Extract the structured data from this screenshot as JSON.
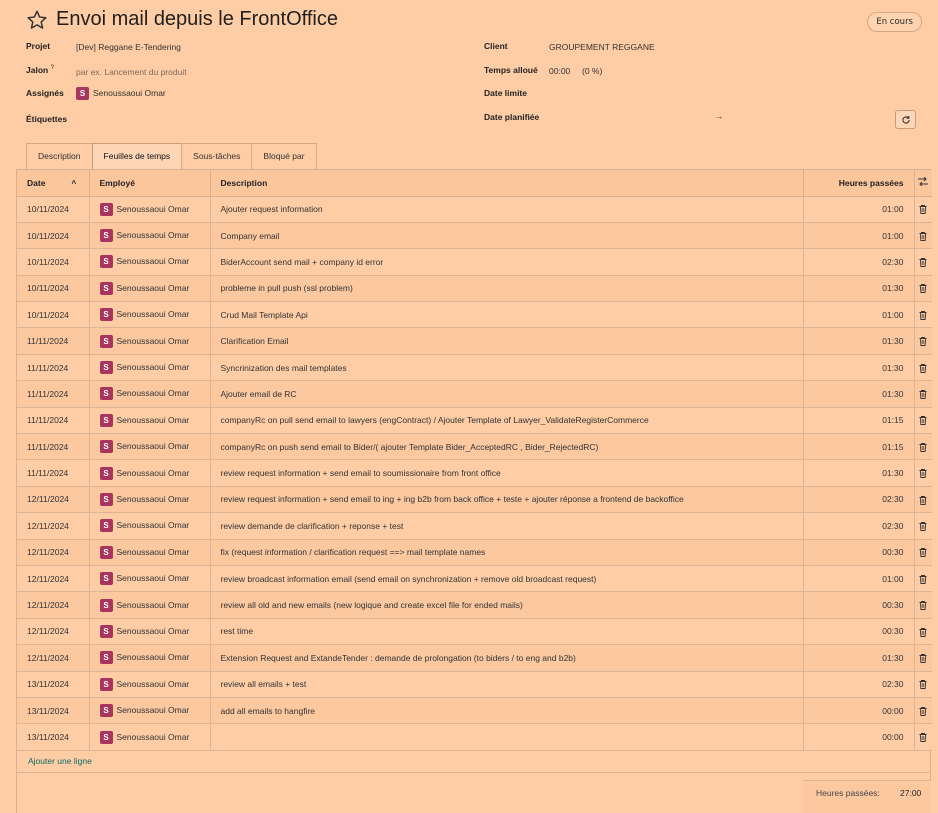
{
  "header": {
    "title": "Envoi mail depuis le FrontOffice",
    "status": "En cours"
  },
  "fields": {
    "project_label": "Projet",
    "project_value": "[Dev] Reggane E-Tendering",
    "milestone_label": "Jalon",
    "milestone_sup": "?",
    "milestone_placeholder": "par ex. Lancement du produit",
    "assignees_label": "Assignés",
    "assignee_initial": "S",
    "assignee_name": "Senoussaoui Omar",
    "tags_label": "Étiquettes",
    "client_label": "Client",
    "client_value": "GROUPEMENT REGGANE",
    "time_label": "Temps alloué",
    "time_value": "00:00",
    "time_percent": "(0 %)",
    "deadline_label": "Date limite",
    "planned_label": "Date planifiée",
    "planned_arrow": "→"
  },
  "tabs": [
    "Description",
    "Feuilles de temps",
    "Sous-tâches",
    "Bloqué par"
  ],
  "table": {
    "headers": {
      "date": "Date",
      "employee": "Employé",
      "description": "Description",
      "hours": "Heures passées"
    },
    "rows": [
      {
        "date": "10/11/2024",
        "employee": "Senoussaoui Omar",
        "description": "Ajouter request information",
        "hours": "01:00"
      },
      {
        "date": "10/11/2024",
        "employee": "Senoussaoui Omar",
        "description": "Company email",
        "hours": "01:00"
      },
      {
        "date": "10/11/2024",
        "employee": "Senoussaoui Omar",
        "description": "BiderAccount send mail + company id error",
        "hours": "02:30"
      },
      {
        "date": "10/11/2024",
        "employee": "Senoussaoui Omar",
        "description": "probleme in pull push (ssl problem)",
        "hours": "01:30"
      },
      {
        "date": "10/11/2024",
        "employee": "Senoussaoui Omar",
        "description": "Crud Mail Template Api",
        "hours": "01:00"
      },
      {
        "date": "11/11/2024",
        "employee": "Senoussaoui Omar",
        "description": "Clarification Email",
        "hours": "01:30"
      },
      {
        "date": "11/11/2024",
        "employee": "Senoussaoui Omar",
        "description": "Syncrinization des mail templates",
        "hours": "01:30"
      },
      {
        "date": "11/11/2024",
        "employee": "Senoussaoui Omar",
        "description": "Ajouter email de RC",
        "hours": "01:30"
      },
      {
        "date": "11/11/2024",
        "employee": "Senoussaoui Omar",
        "description": "companyRc on pull send email to lawyers (engContract) / Ajouter Template of Lawyer_ValidateRegisterCommerce",
        "hours": "01:15"
      },
      {
        "date": "11/11/2024",
        "employee": "Senoussaoui Omar",
        "description": "companyRc on push send email to Bider/( ajouter Template Bider_AcceptedRC , Bider_RejectedRC)",
        "hours": "01:15"
      },
      {
        "date": "11/11/2024",
        "employee": "Senoussaoui Omar",
        "description": "review request information + send email to soumissionaire from front office",
        "hours": "01:30"
      },
      {
        "date": "12/11/2024",
        "employee": "Senoussaoui Omar",
        "description": "review request information + send email to ing + ing b2b from back office + teste + ajouter réponse a frontend de backoffice",
        "hours": "02:30"
      },
      {
        "date": "12/11/2024",
        "employee": "Senoussaoui Omar",
        "description": "review demande de clarification + reponse + test",
        "hours": "02:30"
      },
      {
        "date": "12/11/2024",
        "employee": "Senoussaoui Omar",
        "description": "fix (request information / clarification request ==> mail template names",
        "hours": "00:30"
      },
      {
        "date": "12/11/2024",
        "employee": "Senoussaoui Omar",
        "description": "review broadcast information email (send email on synchronization + remove old broadcast request)",
        "hours": "01:00"
      },
      {
        "date": "12/11/2024",
        "employee": "Senoussaoui Omar",
        "description": "review all old and new emails (new logique and create excel file for ended mails)",
        "hours": "00:30"
      },
      {
        "date": "12/11/2024",
        "employee": "Senoussaoui Omar",
        "description": "rest time",
        "hours": "00:30"
      },
      {
        "date": "12/11/2024",
        "employee": "Senoussaoui Omar",
        "description": "Extension Request and ExtandeTender : demande de prolongation (to biders / to eng and b2b)",
        "hours": "01:30"
      },
      {
        "date": "13/11/2024",
        "employee": "Senoussaoui Omar",
        "description": "review all emails + test",
        "hours": "02:30"
      },
      {
        "date": "13/11/2024",
        "employee": "Senoussaoui Omar",
        "description": "add all emails to hangfire",
        "hours": "00:00"
      },
      {
        "date": "13/11/2024",
        "employee": "Senoussaoui Omar",
        "description": "",
        "hours": "00:00"
      }
    ]
  },
  "add_line": "Ajouter une ligne",
  "footer": {
    "total_label": "Heures passées:",
    "total_value": "27:00"
  },
  "colors": {
    "background": "#fecda5",
    "avatar": "#a8355e",
    "link": "#0b6b63"
  },
  "icons": [
    "star-icon",
    "reload-icon",
    "sort-up-icon",
    "column-options-icon",
    "trash-icon"
  ]
}
